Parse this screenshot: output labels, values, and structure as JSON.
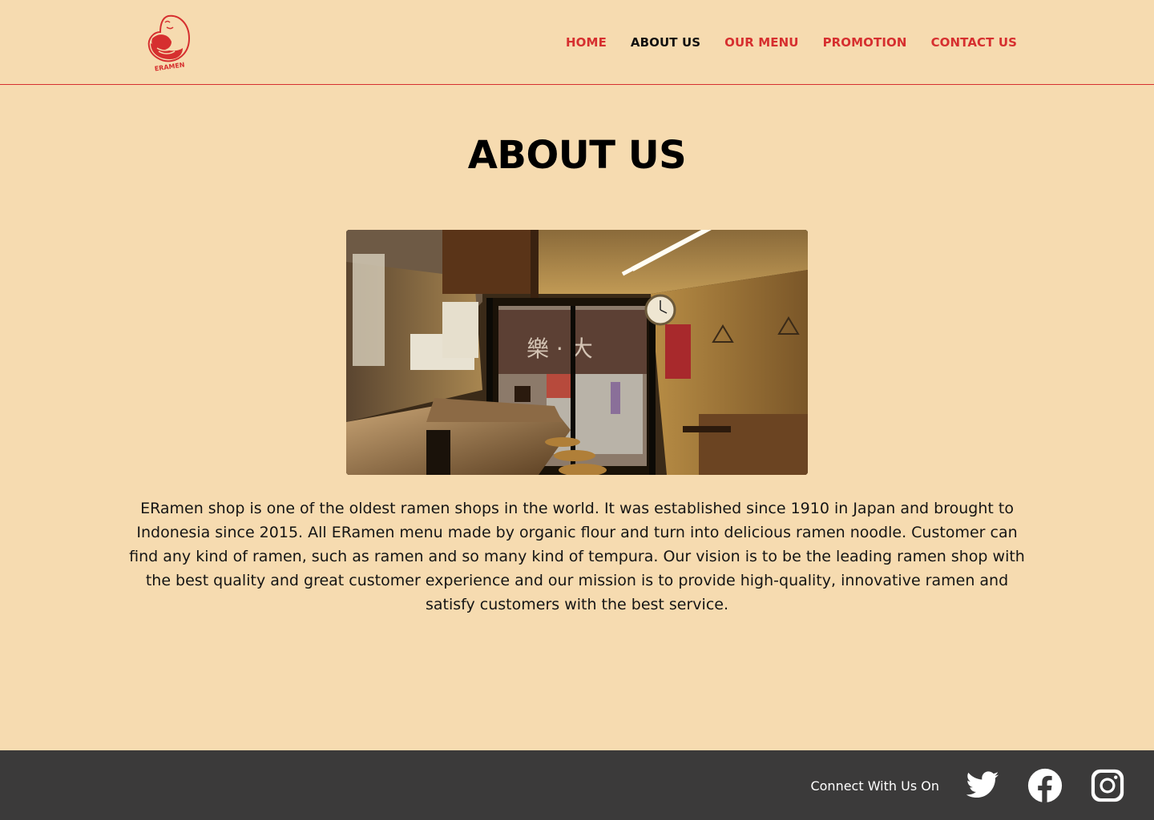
{
  "header": {
    "logo_text": "ERAMEN",
    "nav": [
      {
        "label": "HOME",
        "active": false
      },
      {
        "label": "ABOUT US",
        "active": true
      },
      {
        "label": "OUR MENU",
        "active": false
      },
      {
        "label": "PROMOTION",
        "active": false
      },
      {
        "label": "CONTACT US",
        "active": false
      }
    ]
  },
  "main": {
    "title": "ABOUT US",
    "description": "ERamen shop is one of the oldest ramen shops in the world. It was established since 1910 in Japan and brought to Indonesia since 2015. All ERamen menu made by organic flour and turn into delicious ramen noodle. Customer can find any kind of ramen, such as ramen and so many kind of tempura. Our vision is to be the leading ramen shop with the best quality and great customer experience and our mission is to provide high-quality, innovative ramen and satisfy customers with the best service."
  },
  "footer": {
    "connect_label": "Connect With Us On",
    "social": [
      "twitter-icon",
      "facebook-icon",
      "instagram-icon"
    ]
  },
  "colors": {
    "background": "#f6dbb0",
    "accent": "#d62f2f",
    "footer": "#3b3a3a"
  }
}
